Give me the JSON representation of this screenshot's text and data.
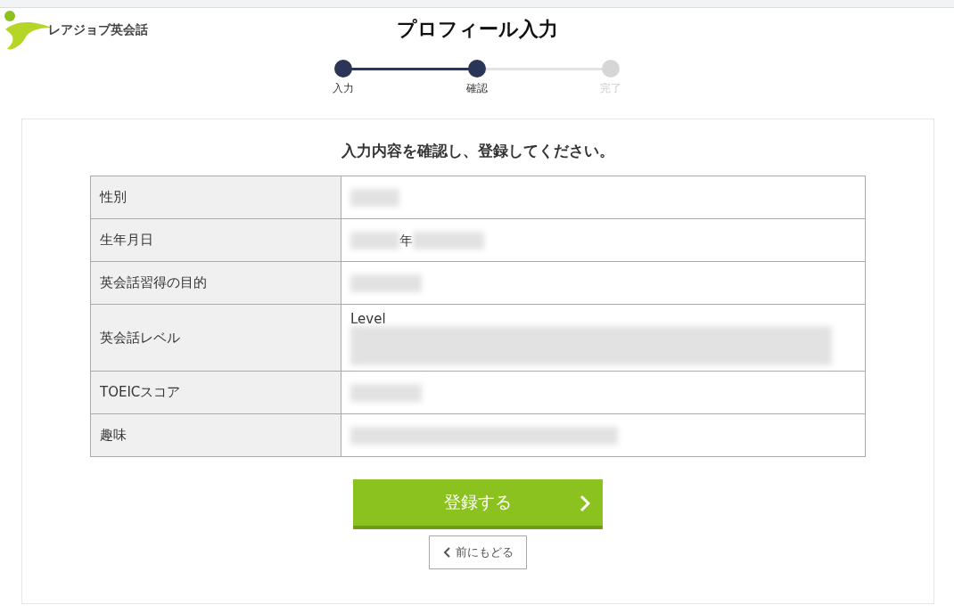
{
  "logo": {
    "text": "レアジョブ英会話"
  },
  "title": "プロフィール入力",
  "steps": [
    {
      "label": "入力",
      "completed": true
    },
    {
      "label": "確認",
      "completed": true
    },
    {
      "label": "完了",
      "completed": false
    }
  ],
  "heading": "入力内容を確認し、登録してください。",
  "rows": [
    {
      "label": "性別",
      "value": [
        {
          "kind": "redacted"
        }
      ]
    },
    {
      "label": "生年月日",
      "value": [
        {
          "kind": "redacted"
        },
        {
          "kind": "text",
          "text": "年"
        },
        {
          "kind": "redacted"
        }
      ]
    },
    {
      "label": "英会話習得の目的",
      "value": [
        {
          "kind": "redacted"
        }
      ]
    },
    {
      "label": "英会話レベル",
      "value": [
        {
          "kind": "text",
          "text": "Level"
        },
        {
          "kind": "redacted"
        }
      ]
    },
    {
      "label": "TOEICスコア",
      "value": [
        {
          "kind": "redacted"
        }
      ]
    },
    {
      "label": "趣味",
      "value": [
        {
          "kind": "redacted"
        }
      ]
    }
  ],
  "submit_button": "登録する",
  "back_button": "前にもどる"
}
